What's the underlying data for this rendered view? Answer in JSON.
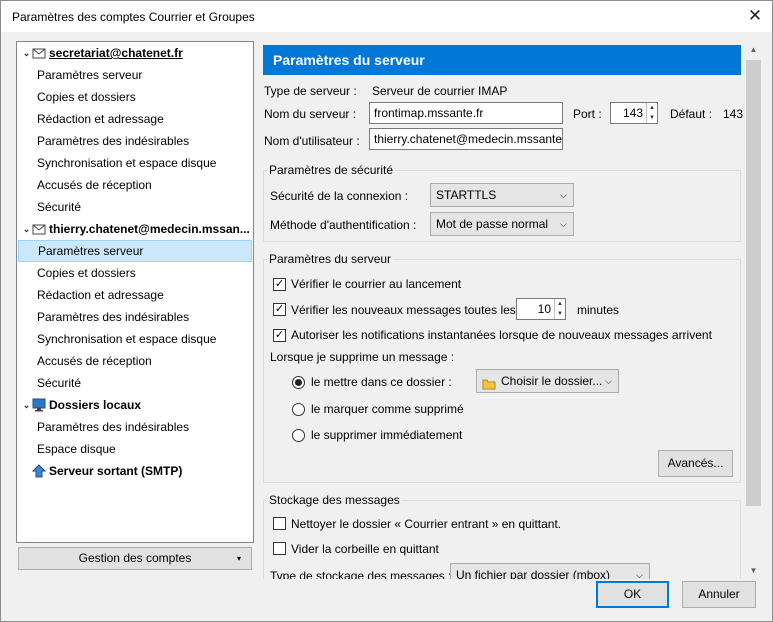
{
  "window": {
    "title": "Paramètres des comptes Courrier et Groupes"
  },
  "tree": {
    "accounts": [
      {
        "name": "secretariat@chatenet.fr",
        "items": [
          "Paramètres serveur",
          "Copies et dossiers",
          "Rédaction et adressage",
          "Paramètres des indésirables",
          "Synchronisation et espace disque",
          "Accusés de réception",
          "Sécurité"
        ]
      },
      {
        "name": "thierry.chatenet@medecin.mssan...",
        "items": [
          "Paramètres serveur",
          "Copies et dossiers",
          "Rédaction et adressage",
          "Paramètres des indésirables",
          "Synchronisation et espace disque",
          "Accusés de réception",
          "Sécurité"
        ]
      },
      {
        "name": "Dossiers locaux",
        "items": [
          "Paramètres des indésirables",
          "Espace disque"
        ]
      },
      {
        "name": "Serveur sortant (SMTP)",
        "items": []
      }
    ]
  },
  "manage_button": "Gestion des comptes",
  "pane": {
    "header": "Paramètres du serveur",
    "server_type_label": "Type de serveur :",
    "server_type_value": "Serveur de courrier IMAP",
    "server_name_label": "Nom du serveur :",
    "server_name_value": "frontimap.mssante.fr",
    "port_label": "Port :",
    "port_value": "143",
    "default_label": "Défaut :",
    "default_value": "143",
    "username_label": "Nom d'utilisateur :",
    "username_value": "thierry.chatenet@medecin.mssante",
    "security": {
      "title": "Paramètres de sécurité",
      "connection_label": "Sécurité de la connexion :",
      "connection_value": "STARTTLS",
      "auth_label": "Méthode d'authentification :",
      "auth_value": "Mot de passe normal"
    },
    "server_settings": {
      "title": "Paramètres du serveur",
      "check_startup": "Vérifier le courrier au lancement",
      "check_every": "Vérifier les nouveaux messages toutes les",
      "minutes_value": "10",
      "minutes_label": "minutes",
      "allow_push": "Autoriser les notifications instantanées lorsque de nouveaux messages arrivent",
      "on_delete_label": "Lorsque je supprime un message :",
      "move_to_folder": "le mettre dans ce dossier :",
      "choose_folder": "Choisir le dossier...",
      "mark_deleted": "le marquer comme supprimé",
      "delete_now": "le supprimer immédiatement",
      "advanced": "Avancés..."
    },
    "storage": {
      "title": "Stockage des messages",
      "clean_inbox": "Nettoyer le dossier « Courrier entrant » en quittant.",
      "empty_trash": "Vider la corbeille en quittant",
      "store_type_label": "Type de stockage des messages :",
      "store_type_value": "Un fichier par dossier (mbox)"
    }
  },
  "buttons": {
    "ok": "OK",
    "cancel": "Annuler"
  }
}
